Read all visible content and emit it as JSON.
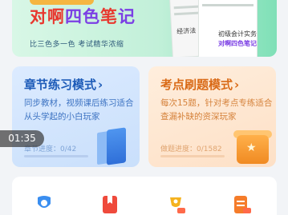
{
  "banner": {
    "title_parts": [
      "对啊",
      "四色",
      "笔",
      "记"
    ],
    "subtitle": "比三色多一色   考试精华浓缩",
    "book_title_1": "经济法",
    "book_side": "初级会计实务",
    "book_title_2": "对啊四色笔记"
  },
  "cards": [
    {
      "title": "章节练习模式",
      "arrow": "›",
      "desc": "同步教材，视频课后练习适合从头学起的小白玩家",
      "progress": "章节进度：0/42",
      "progress_fraction": 0
    },
    {
      "title": "考点刷题模式",
      "arrow": "›",
      "desc": "每次15题，针对考点专练适合查漏补缺的资深玩家",
      "progress": "做题进度：0/1582",
      "progress_fraction": 0
    }
  ],
  "time_pill": "01:35",
  "bottom_icons": [
    {
      "name": "blue-medal-icon",
      "color": "#3a8ef0"
    },
    {
      "name": "red-bookmark-icon",
      "color": "#ef4a3c"
    },
    {
      "name": "trophy-vip-icon",
      "color": "#f5b21f"
    },
    {
      "name": "orange-list-vip-icon",
      "color": "#f57c2a"
    }
  ]
}
